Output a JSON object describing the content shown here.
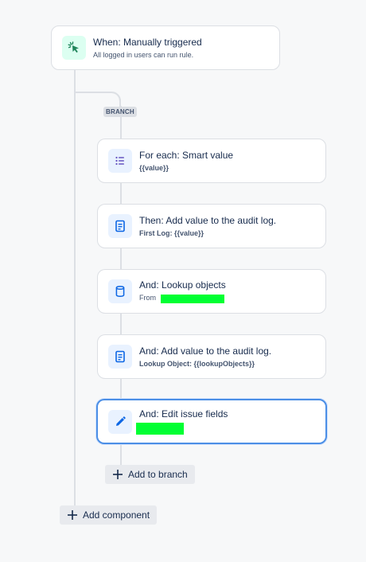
{
  "trigger": {
    "title": "When: Manually triggered",
    "subtitle": "All logged in users can run rule.",
    "icon": "cursor-click-icon"
  },
  "branch": {
    "label": "BRANCH",
    "steps": [
      {
        "title": "For each: Smart value",
        "subtitle": "{{value}}",
        "icon": "list-icon"
      },
      {
        "title": "Then: Add value to the audit log.",
        "subtitle": "First Log: {{value}}",
        "icon": "document-icon"
      },
      {
        "title": "And: Lookup objects",
        "subtitle_prefix": "From",
        "icon": "database-icon"
      },
      {
        "title": "And: Add value to the audit log.",
        "subtitle": "Lookup Object: {{lookupObjects}}",
        "icon": "document-icon"
      },
      {
        "title": "And: Edit issue fields",
        "icon": "pencil-icon"
      }
    ],
    "add_label": "Add to branch"
  },
  "add_component_label": "Add component",
  "colors": {
    "accent": "#4c8fe6",
    "trigger_icon": "#1f845a",
    "action_icon": "#0c66e4",
    "redaction": "#00ff33"
  }
}
